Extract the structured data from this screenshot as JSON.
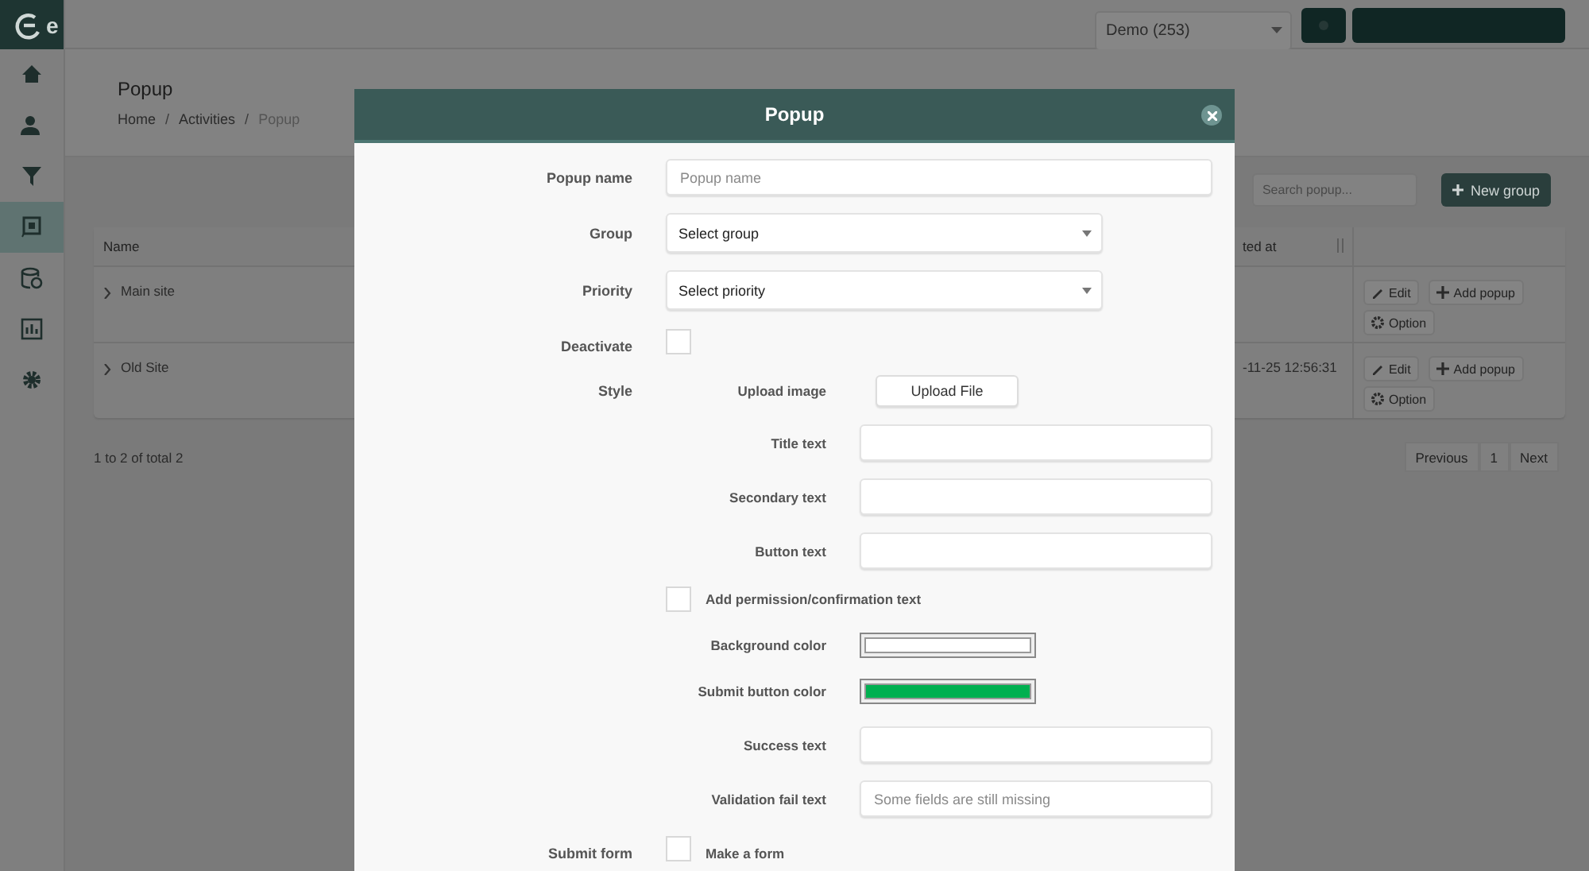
{
  "app": {
    "logo_text": "e",
    "account_selector": "Demo (253)",
    "sidebar": {
      "items": [
        {
          "selected": false
        },
        {
          "selected": false
        },
        {
          "selected": false
        },
        {
          "selected": true
        },
        {
          "selected": false
        },
        {
          "selected": false
        },
        {
          "selected": false
        }
      ]
    },
    "page_title": "Popup",
    "breadcrumb": [
      {
        "kind": "link",
        "text": "Home"
      },
      {
        "kind": "separator",
        "text": "/"
      },
      {
        "kind": "link",
        "text": "Activities"
      },
      {
        "kind": "separator",
        "text": "/"
      },
      {
        "kind": "current",
        "text": "Popup"
      }
    ],
    "search": {
      "placeholder": "Search popup..."
    },
    "new_group_button": "New group",
    "table": {
      "columns": [
        "Name",
        "ted at"
      ],
      "rows": [
        {
          "name": "Main site",
          "column_2": "",
          "actions": [
            "Edit",
            "Add popup",
            "Option"
          ]
        },
        {
          "name": "Old Site",
          "column_2": "-11-25 12:56:31",
          "actions": [
            "Edit",
            "Add popup",
            "Option"
          ]
        }
      ]
    },
    "count_text": "1 to 2 of total 2",
    "pagination": [
      "Previous",
      "1",
      "Next"
    ]
  },
  "modal": {
    "title": "Popup",
    "fields": [
      {
        "kind": "text",
        "label": "Popup name",
        "placeholder": "Popup name"
      },
      {
        "kind": "select",
        "label": "Group",
        "value": "Select group"
      },
      {
        "kind": "select",
        "label": "Priority",
        "value": "Select priority"
      },
      {
        "kind": "checkbox",
        "label": "Deactivate",
        "checked": false
      }
    ],
    "style": {
      "label": "Style",
      "items": [
        {
          "kind": "upload",
          "label": "Upload image",
          "button": "Upload File"
        },
        {
          "kind": "text",
          "label": "Title text"
        },
        {
          "kind": "text",
          "label": "Secondary text"
        },
        {
          "kind": "text",
          "label": "Button text"
        },
        {
          "kind": "checkbox",
          "label": "Add permission/confirmation text",
          "checked": false
        },
        {
          "kind": "color",
          "label": "Background color",
          "color": "#ffffff"
        },
        {
          "kind": "color",
          "label": "Submit button color",
          "color": "#00b050"
        },
        {
          "kind": "text",
          "label": "Success text"
        },
        {
          "kind": "text",
          "label": "Validation fail text",
          "placeholder": "Some fields are still missing"
        }
      ]
    },
    "submit_form": {
      "label": "Submit form",
      "option": "Make a form",
      "checked": false
    }
  }
}
